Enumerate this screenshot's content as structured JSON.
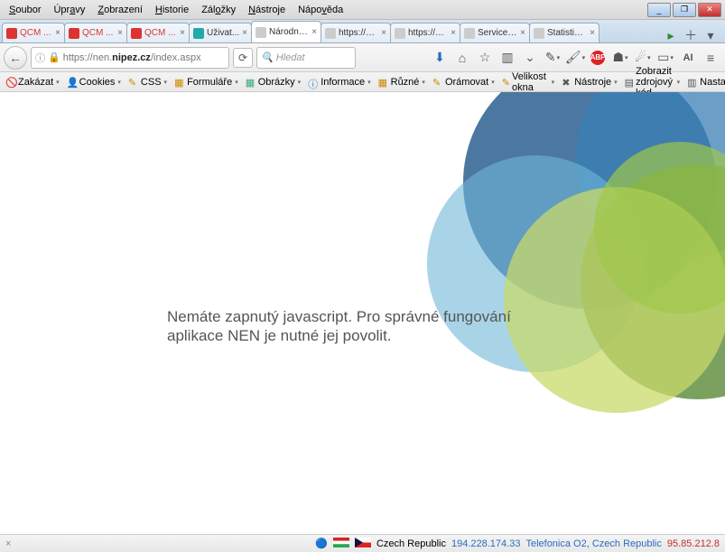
{
  "menu": {
    "items": [
      "Soubor",
      "Úpravy",
      "Zobrazení",
      "Historie",
      "Záložky",
      "Nástroje",
      "Nápověda"
    ]
  },
  "window": {
    "min": "_",
    "max": "❐",
    "close": "✕"
  },
  "tabs": [
    {
      "label": "QCM ...",
      "fav": "#d33",
      "text": "#d33"
    },
    {
      "label": "QCM ...",
      "fav": "#d33",
      "text": "#d33"
    },
    {
      "label": "QCM ...",
      "fav": "#d33",
      "text": "#d33"
    },
    {
      "label": "Uživat...",
      "fav": "#2aa",
      "text": "#333"
    },
    {
      "label": "Národní e...",
      "fav": "#ccc",
      "text": "#333",
      "active": true
    },
    {
      "label": "https://ne...",
      "fav": "#ccc",
      "text": "#333"
    },
    {
      "label": "https://ne...",
      "fav": "#ccc",
      "text": "#333"
    },
    {
      "label": "ServiceDesk",
      "fav": "#ccc",
      "text": "#333"
    },
    {
      "label": "Statistiky -...",
      "fav": "#ccc",
      "text": "#333"
    }
  ],
  "url": {
    "prefix": "https://nen.",
    "host": "nipez.cz",
    "suffix": "/index.aspx"
  },
  "search": {
    "placeholder": "Hledat"
  },
  "devtools": [
    {
      "label": "Zakázat",
      "icon": "🚫",
      "color": "#d33"
    },
    {
      "label": "Cookies",
      "icon": "👤",
      "color": "#333"
    },
    {
      "label": "CSS",
      "icon": "✎",
      "color": "#c80"
    },
    {
      "label": "Formuláře",
      "icon": "▦",
      "color": "#c80"
    },
    {
      "label": "Obrázky",
      "icon": "▦",
      "color": "#3a7"
    },
    {
      "label": "Informace",
      "icon": "ⓘ",
      "color": "#27c"
    },
    {
      "label": "Různé",
      "icon": "▦",
      "color": "#c80"
    },
    {
      "label": "Orámovat",
      "icon": "✎",
      "color": "#c80"
    },
    {
      "label": "Velikost okna",
      "icon": "✎",
      "color": "#c80"
    },
    {
      "label": "Nástroje",
      "icon": "✖",
      "color": "#555"
    },
    {
      "label": "Zobrazit zdrojový kód",
      "icon": "▤",
      "color": "#555"
    },
    {
      "label": "Nastavení",
      "icon": "▥",
      "color": "#555"
    }
  ],
  "page": {
    "message": "Nemáte zapnutý javascript. Pro správné fungování aplikace NEN je nutné jej povolit."
  },
  "status": {
    "country": "Czech Republic",
    "ip1": "194.228.174.33",
    "isp": "Telefonica O2, Czech Republic",
    "ip2": "95.85.212.8"
  }
}
